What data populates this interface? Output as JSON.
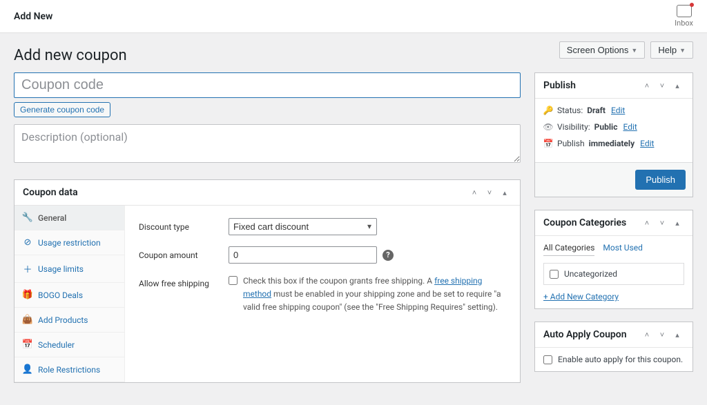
{
  "topbar": {
    "title": "Add New",
    "inbox_label": "Inbox"
  },
  "header": {
    "page_title": "Add new coupon",
    "screen_options": "Screen Options",
    "help": "Help"
  },
  "form": {
    "code_placeholder": "Coupon code",
    "generate_label": "Generate coupon code",
    "desc_placeholder": "Description (optional)"
  },
  "coupon_data": {
    "title": "Coupon data",
    "tabs": {
      "general": "General",
      "usage_restriction": "Usage restriction",
      "usage_limits": "Usage limits",
      "bogo": "BOGO Deals",
      "add_products": "Add Products",
      "scheduler": "Scheduler",
      "role": "Role Restrictions"
    },
    "discount_type_label": "Discount type",
    "discount_type_value": "Fixed cart discount",
    "coupon_amount_label": "Coupon amount",
    "coupon_amount_value": "0",
    "free_ship_label": "Allow free shipping",
    "free_ship_pre": "Check this box if the coupon grants free shipping. A ",
    "free_ship_link": "free shipping method",
    "free_ship_post": " must be enabled in your shipping zone and be set to require \"a valid free shipping coupon\" (see the \"Free Shipping Requires\" setting)."
  },
  "publish": {
    "title": "Publish",
    "status_label": "Status:",
    "status_value": "Draft",
    "visibility_label": "Visibility:",
    "visibility_value": "Public",
    "schedule_label": "Publish",
    "schedule_value": "immediately",
    "edit": "Edit",
    "button": "Publish"
  },
  "categories": {
    "title": "Coupon Categories",
    "tab_all": "All Categories",
    "tab_most": "Most Used",
    "item_uncat": "Uncategorized",
    "add_new": "+ Add New Category"
  },
  "auto_apply": {
    "title": "Auto Apply Coupon",
    "label": "Enable auto apply for this coupon."
  }
}
